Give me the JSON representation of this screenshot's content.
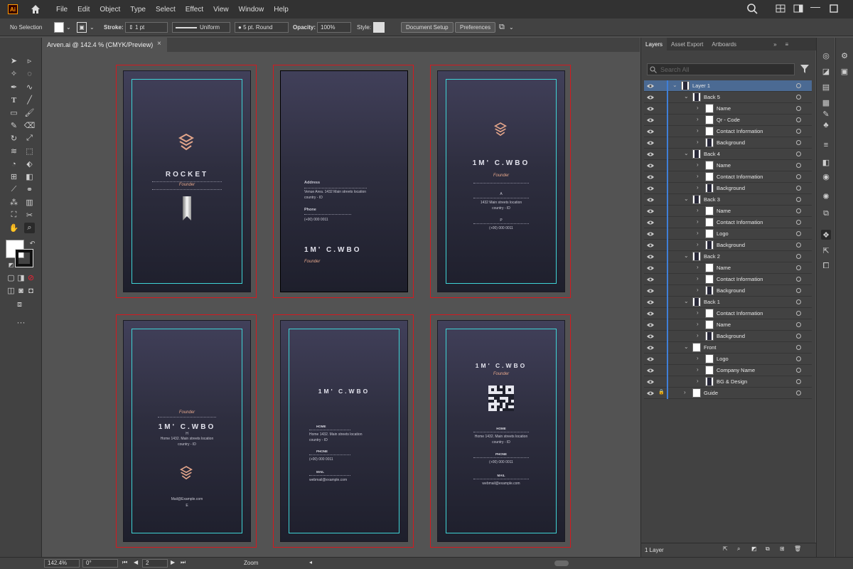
{
  "app": {
    "logo_text": "Ai"
  },
  "menu": [
    "File",
    "Edit",
    "Object",
    "Type",
    "Select",
    "Effect",
    "View",
    "Window",
    "Help"
  ],
  "control": {
    "selection": "No Selection",
    "stroke_label": "Stroke:",
    "stroke_value": "1 pt",
    "stroke_style": "Uniform",
    "brush": "5 pt. Round",
    "opacity_label": "Opacity:",
    "opacity_value": "100%",
    "style_label": "Style:",
    "doc_setup": "Document Setup",
    "preferences": "Preferences"
  },
  "tab": {
    "title": "Arven.ai @ 142.4 % (CMYK/Preview)",
    "close": "×"
  },
  "cards": [
    {
      "title": "ROCKET",
      "role": "Founder"
    },
    {
      "address_label": "Address",
      "address": "Venue Area. 1432 Main streets location",
      "country": "country - ID",
      "phone_label": "Phone",
      "phone": "(+00) 000 0011",
      "name": "1M' C.WBO",
      "role": "Founder"
    },
    {
      "name": "1M' C.WBO",
      "role": "Founder",
      "sym": "A",
      "address": "1432 Main streets location",
      "country": "country - ID",
      "sym2": "P",
      "phone": "(+00) 000 0011"
    },
    {
      "role": "Founder",
      "name": "1M' C.WBO",
      "sym": "H",
      "address": "Home 1432. Main streets location",
      "country": "country - ID",
      "email": "Mail@Example.com",
      "sym2": "E"
    },
    {
      "name": "1M' C.WBO",
      "home_label": "HOME",
      "address": "Home 1432. Main streets location",
      "country": "country - ID",
      "phone_label": "PHONE",
      "phone": "(+00) 000 0011",
      "mail_label": "MAIL",
      "email": "webmail@example.com"
    },
    {
      "name": "1M' C.WBO",
      "role": "Founder",
      "home_label": "HOME",
      "address": "Home 1432. Main streets location",
      "country": "country - ID",
      "phone_label": "PHONE",
      "phone": "(+00) 000 0011",
      "mail_label": "MAIL",
      "email": "webmail@example.com"
    }
  ],
  "panel": {
    "tabs": [
      "Layers",
      "Asset Export",
      "Artboards"
    ],
    "search_placeholder": "Search All",
    "footer": "1 Layer"
  },
  "layers": [
    {
      "name": "Layer 1",
      "depth": 0
    },
    {
      "name": "Back 5",
      "depth": 1
    },
    {
      "name": "Name",
      "depth": 2
    },
    {
      "name": "Qr - Code",
      "depth": 2
    },
    {
      "name": "Contact Information",
      "depth": 2
    },
    {
      "name": "Background",
      "depth": 2
    },
    {
      "name": "Back 4",
      "depth": 1
    },
    {
      "name": "Name",
      "depth": 2
    },
    {
      "name": "Contact Information",
      "depth": 2
    },
    {
      "name": "Background",
      "depth": 2
    },
    {
      "name": "Back 3",
      "depth": 1
    },
    {
      "name": "Name",
      "depth": 2
    },
    {
      "name": "Contact Information",
      "depth": 2
    },
    {
      "name": "Logo",
      "depth": 2
    },
    {
      "name": "Background",
      "depth": 2
    },
    {
      "name": "Back 2",
      "depth": 1
    },
    {
      "name": "Name",
      "depth": 2
    },
    {
      "name": "Contact Information",
      "depth": 2
    },
    {
      "name": "Background",
      "depth": 2
    },
    {
      "name": "Back 1",
      "depth": 1
    },
    {
      "name": "Contact Information",
      "depth": 2
    },
    {
      "name": "Name",
      "depth": 2
    },
    {
      "name": "Background",
      "depth": 2
    },
    {
      "name": "Front",
      "depth": 1
    },
    {
      "name": "Logo",
      "depth": 2
    },
    {
      "name": "Company Name",
      "depth": 2
    },
    {
      "name": "BG & Design",
      "depth": 2
    },
    {
      "name": "Guide",
      "depth": 1
    }
  ],
  "status": {
    "zoom": "142.4%",
    "rotate": "0°",
    "artboard": "2",
    "tool": "Zoom"
  },
  "colors": {
    "accent": "#3f7fd8",
    "guide": "#3fd4d6",
    "artboard_border": "#d4191f",
    "copper": "#e3a58a"
  }
}
